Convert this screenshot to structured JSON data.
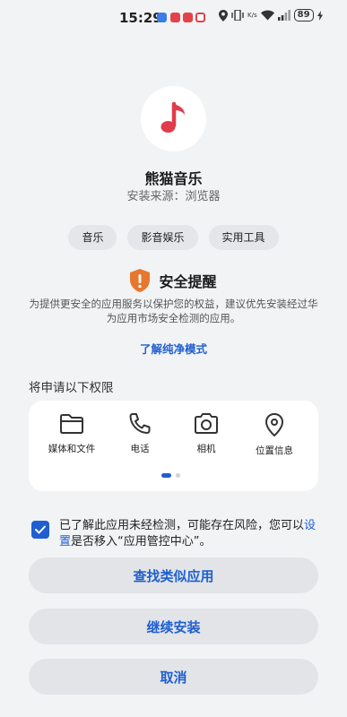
{
  "status_bar": {
    "time": "15:29",
    "network_speed": "K/s",
    "battery": "89",
    "notif_colors": [
      "#3b7ce6",
      "#e3424b",
      "#e3424b",
      "#e3424b",
      "#e3424b"
    ]
  },
  "app": {
    "name": "熊猫音乐",
    "source": "安装来源：浏览器",
    "icon": "music-note-icon",
    "icon_color": "#e03c4b",
    "tags": [
      "音乐",
      "影音娱乐",
      "实用工具"
    ]
  },
  "security": {
    "title": "安全提醒",
    "body": "为提供更安全的应用服务以保护您的权益，建议优先安装经过华为应用市场安全检测的应用。",
    "link": "了解纯净模式",
    "shield_color": "#e8772e"
  },
  "permissions": {
    "header": "将申请以下权限",
    "items": [
      {
        "label": "媒体和文件",
        "icon": "folder-icon"
      },
      {
        "label": "电话",
        "icon": "phone-icon"
      },
      {
        "label": "相机",
        "icon": "camera-icon"
      },
      {
        "label": "位置信息",
        "icon": "location-pin-icon"
      }
    ],
    "page_count": 2,
    "current_page": 1
  },
  "consent": {
    "checked": true,
    "text_before": "已了解此应用未经检测，可能存在风险，您可以",
    "link": "设置",
    "text_after": "是否移入“应用管控中心”。"
  },
  "buttons": {
    "find_similar": "查找类似应用",
    "continue_install": "继续安装",
    "cancel": "取消"
  },
  "colors": {
    "accent": "#1f5fd0",
    "background": "#f1f3f5"
  }
}
